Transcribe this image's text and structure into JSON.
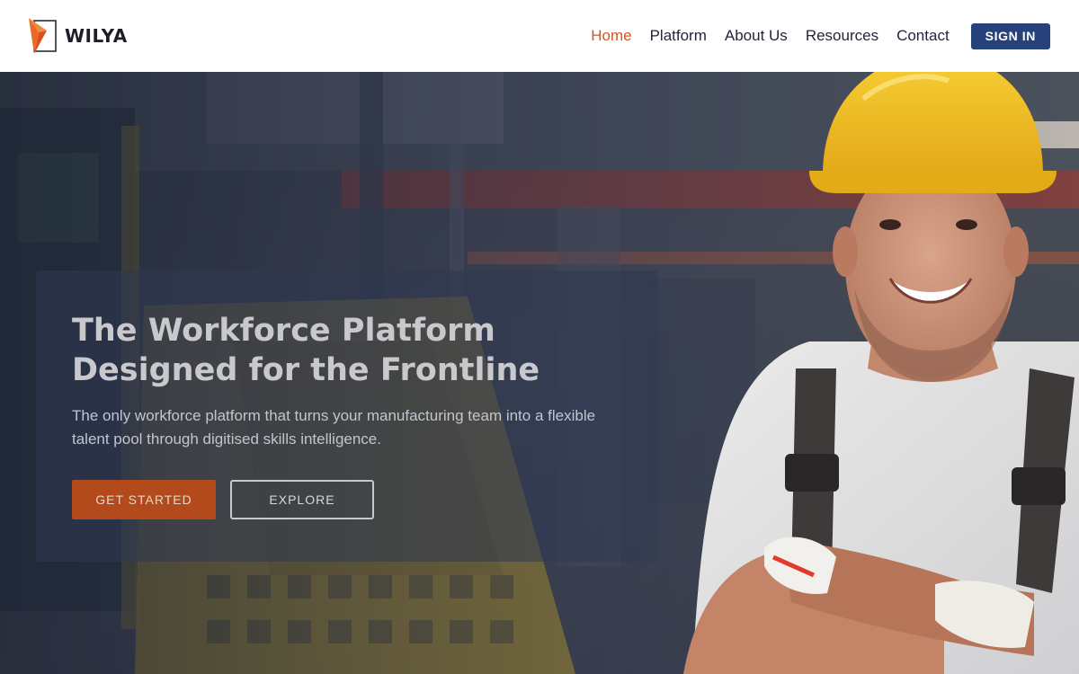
{
  "header": {
    "brand_name": "WILYA",
    "brand_accent": "#e2672a",
    "nav": [
      {
        "label": "Home",
        "active": true
      },
      {
        "label": "Platform",
        "active": false
      },
      {
        "label": "About Us",
        "active": false
      },
      {
        "label": "Resources",
        "active": false
      },
      {
        "label": "Contact",
        "active": false
      }
    ],
    "sign_in_label": "SIGN IN",
    "active_color": "#d4541c",
    "sign_in_color": "#27427a"
  },
  "hero": {
    "title_line_1": "The Workforce Platform",
    "title_line_2": "Designed for the Frontline",
    "subtitle": "The only workforce platform that turns your manufacturing team into a flexible talent pool through digitised skills intelligence.",
    "primary_button_label": "GET STARTED",
    "secondary_button_label": "EXPLORE",
    "primary_button_color": "#b24a1c"
  }
}
